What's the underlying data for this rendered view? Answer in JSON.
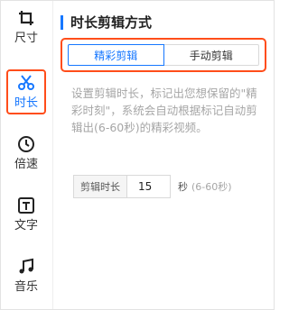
{
  "sidebar": {
    "items": [
      {
        "label": "尺寸",
        "icon": "crop-icon"
      },
      {
        "label": "时长",
        "icon": "scissors-icon",
        "active": true
      },
      {
        "label": "倍速",
        "icon": "clock-icon"
      },
      {
        "label": "文字",
        "icon": "text-icon"
      },
      {
        "label": "音乐",
        "icon": "music-icon"
      }
    ]
  },
  "main": {
    "title": "时长剪辑方式",
    "modes": [
      "精彩剪辑",
      "手动剪辑"
    ],
    "selected_mode": "精彩剪辑",
    "description": "设置剪辑时长，标记出您想保留的\"精彩时刻\"，系统会自动根据标记自动剪辑出(6-60秒)的精彩视频。",
    "duration": {
      "label": "剪辑时长",
      "value": "15",
      "unit": "秒",
      "range": "(6-60秒)"
    }
  },
  "colors": {
    "accent": "#1677ff",
    "highlight_border": "#ff4d1a",
    "muted_text": "#a6a6a6"
  }
}
